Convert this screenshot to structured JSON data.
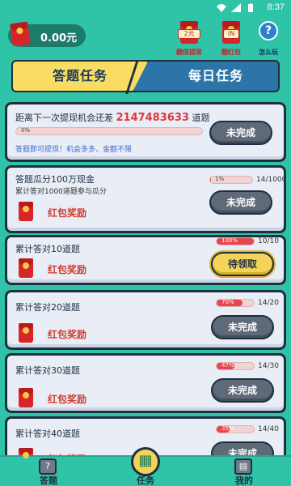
{
  "status_bar": {
    "time": "8:37"
  },
  "top_bar": {
    "balance": "0.00元",
    "actions": [
      {
        "tag": "2元",
        "label": "翻倍提现"
      },
      {
        "tag": "IN",
        "label": "翻红包"
      },
      {
        "tag": "?",
        "label": "怎么玩"
      }
    ]
  },
  "tabs": [
    {
      "label": "答题任务",
      "active": true
    },
    {
      "label": "每日任务",
      "active": false
    }
  ],
  "main_card": {
    "title_prefix": "距离下一次提现机会还差",
    "big_number": "2147483633",
    "title_suffix": "道题",
    "progress_label": "0%",
    "progress": 0.0,
    "note": "答题即可提现！机会多多、金额不限",
    "button": "未完成"
  },
  "tasks": [
    {
      "title": "答题瓜分100万现金",
      "subtitle": "累计答对1000道题参与瓜分",
      "percent_label": "1%",
      "progress": 0.01,
      "count": "14/1000",
      "reward": "红包奖励",
      "button": "未完成",
      "claimable": false
    },
    {
      "title": "累计答对10道题",
      "subtitle": "",
      "percent_label": "100%",
      "progress": 1.0,
      "count": "10/10",
      "reward": "红包奖励",
      "button": "待领取",
      "claimable": true
    },
    {
      "title": "累计答对20道题",
      "subtitle": "",
      "percent_label": "70%",
      "progress": 0.7,
      "count": "14/20",
      "reward": "红包奖励",
      "button": "未完成",
      "claimable": false
    },
    {
      "title": "累计答对30道题",
      "subtitle": "",
      "percent_label": "47%",
      "progress": 0.47,
      "count": "14/30",
      "reward": "红包奖励",
      "button": "未完成",
      "claimable": false
    },
    {
      "title": "累计答对40道题",
      "subtitle": "",
      "percent_label": "35%",
      "progress": 0.35,
      "count": "14/40",
      "reward": "红包奖励",
      "button": "未完成",
      "claimable": false
    }
  ],
  "bottom_nav": [
    {
      "label": "答题",
      "icon": "question-icon"
    },
    {
      "label": "任务",
      "icon": "gift-icon",
      "active": true
    },
    {
      "label": "我的",
      "icon": "wallet-icon"
    }
  ],
  "colors": {
    "background": "#2fc3a8",
    "accent_red": "#e2363e",
    "gold": "#f4d35a",
    "tab_blue": "#2b75a9"
  }
}
